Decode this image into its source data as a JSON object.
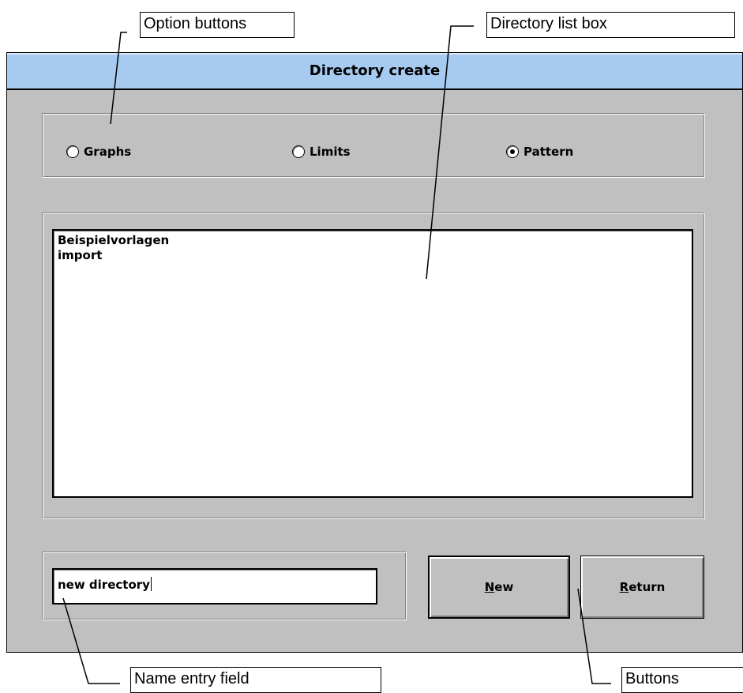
{
  "callouts": {
    "option_buttons": "Option buttons",
    "directory_list_box": "Directory list box",
    "name_entry_field": "Name entry field",
    "buttons": "Buttons"
  },
  "dialog": {
    "title": "Directory create",
    "options": [
      {
        "label": "Graphs",
        "checked": false
      },
      {
        "label": "Limits",
        "checked": false
      },
      {
        "label": "Pattern",
        "checked": true
      }
    ],
    "directories": [
      "Beispielvorlagen",
      "import"
    ],
    "name_entry": {
      "value": "new directory"
    },
    "new_button": {
      "accel": "N",
      "rest": "ew"
    },
    "return_button": {
      "accel": "R",
      "rest": "eturn"
    }
  },
  "colors": {
    "titlebar": "#a6caf0",
    "face": "#c0c0c0"
  }
}
